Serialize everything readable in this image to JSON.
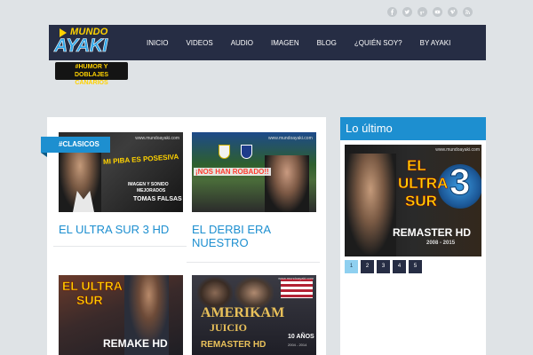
{
  "logo": {
    "top": "MUNDO",
    "main": "AYAKI"
  },
  "tagline": {
    "line1": "#HUMOR Y",
    "line2": "DOBLAJES CANARIOS"
  },
  "social": [
    "facebook-icon",
    "twitter-icon",
    "google-plus-icon",
    "youtube-icon",
    "vimeo-icon",
    "rss-icon"
  ],
  "nav": [
    "INICIO",
    "VIDEOS",
    "AUDIO",
    "IMAGEN",
    "BLOG",
    "¿QUIÉN SOY?",
    "BY AYAKI"
  ],
  "category_badge": "#CLASICOS",
  "posts": [
    {
      "title": "EL ULTRA SUR 3 HD",
      "thumb": {
        "site": "www.mundoayaki.com",
        "line1": "MI PIBA ES POSESIVA",
        "line2": "IMAGEN Y SONIDO",
        "line3": "MEJORADOS",
        "line4": "TOMAS FALSAS"
      }
    },
    {
      "title": "EL DERBI ERA NUESTRO",
      "thumb": {
        "site": "www.mundoayaki.com",
        "line1": "¡NOS HAN ROBADO!!"
      }
    },
    {
      "title": "",
      "thumb": {
        "line1": "EL ULTRA",
        "line2": "SUR",
        "line3": "REMAKE HD"
      }
    },
    {
      "title": "",
      "thumb": {
        "site": "www.mundoayaki.com",
        "line1": "AMERIKAM",
        "line2": "JUICIO",
        "line3": "REMASTER HD",
        "line4": "10 AÑOS",
        "line5": "2004 - 2014"
      }
    }
  ],
  "sidebar": {
    "heading": "Lo último",
    "slide": {
      "site": "www.mundoayaki.com",
      "line1": "EL",
      "line2": "ULTRA",
      "line3": "SUR",
      "number": "3",
      "line4": "REMASTER HD",
      "line5": "2008 - 2015"
    },
    "pages": [
      "1",
      "2",
      "3",
      "4",
      "5"
    ],
    "active_page": "1"
  },
  "colors": {
    "accent": "#1d8fd0",
    "nav_bg": "#262d44",
    "page_bg": "#dfe3e6",
    "thumb_text": "#ffd200"
  }
}
